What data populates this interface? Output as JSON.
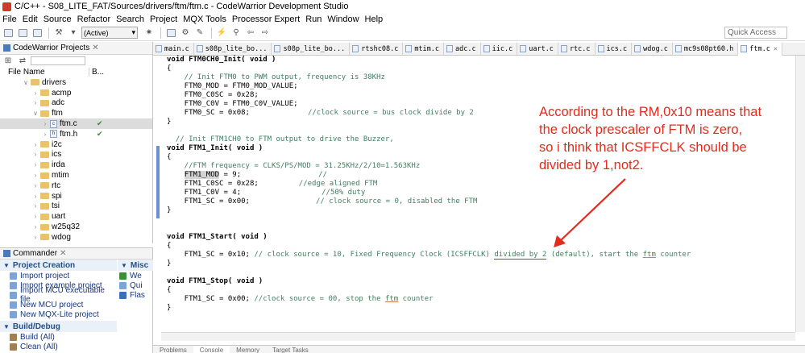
{
  "window": {
    "title": "C/C++ - S08_LITE_FAT/Sources/drivers/ftm/ftm.c - CodeWarrior Development Studio"
  },
  "menu": [
    "File",
    "Edit",
    "Source",
    "Refactor",
    "Search",
    "Project",
    "MQX Tools",
    "Processor Expert",
    "Run",
    "Window",
    "Help"
  ],
  "toolbar": {
    "build_config": "(Active)",
    "quick_access_placeholder": "Quick Access"
  },
  "projects_view": {
    "title": "CodeWarrior Projects",
    "col_file": "File Name",
    "col_b": "B...",
    "tree": [
      {
        "label": "drivers",
        "type": "folder",
        "open": true
      },
      {
        "label": "acmp",
        "type": "folder"
      },
      {
        "label": "adc",
        "type": "folder"
      },
      {
        "label": "ftm",
        "type": "folder",
        "open": true
      },
      {
        "label": "ftm.c",
        "type": "file",
        "mark": "✔",
        "selected": true
      },
      {
        "label": "ftm.h",
        "type": "file",
        "mark": "✔"
      },
      {
        "label": "i2c",
        "type": "folder"
      },
      {
        "label": "ics",
        "type": "folder"
      },
      {
        "label": "irda",
        "type": "folder"
      },
      {
        "label": "mtim",
        "type": "folder"
      },
      {
        "label": "rtc",
        "type": "folder"
      },
      {
        "label": "spi",
        "type": "folder"
      },
      {
        "label": "tsi",
        "type": "folder"
      },
      {
        "label": "uart",
        "type": "folder"
      },
      {
        "label": "w25q32",
        "type": "folder"
      },
      {
        "label": "wdog",
        "type": "folder"
      }
    ]
  },
  "commander": {
    "title": "Commander",
    "sections": [
      {
        "title": "Project Creation",
        "items": [
          "Import project",
          "Import example project",
          "Import MCU executable file",
          "New MCU project",
          "New MQX-Lite project"
        ]
      },
      {
        "title": "Build/Debug",
        "items": [
          "Build (All)",
          "Clean (All)"
        ]
      }
    ],
    "misc_title": "Misc",
    "misc_items": [
      "We",
      "Qui",
      "Flas"
    ]
  },
  "editor_tabs": [
    "main.c",
    "s08p_lite_bo...",
    "s08p_lite_bo...",
    "rtshc08.c",
    "mtim.c",
    "adc.c",
    "iic.c",
    "uart.c",
    "rtc.c",
    "ics.c",
    "wdog.c",
    "mc9s08pt60.h",
    "ftm.c"
  ],
  "code": {
    "l1": "void FTM0CH0_Init( void )",
    "l2": "{",
    "l3": "    // Init FTM0 to PWM output, frequency is 38KHz",
    "l4": "    FTM0_MOD = FTM0_MOD_VALUE;",
    "l5": "    FTM0_C0SC = 0x28;",
    "l6": "    FTM0_C0V = FTM0_C0V_VALUE;",
    "l7a": "    FTM0_SC = 0x08;",
    "l7b": "//clock source = bus clock divide by 2",
    "l8": "}",
    "l9": "  // Init FTM1CH0 to FTM output to drive the Buzzer,",
    "l10": "void FTM1_Init( void )",
    "l11": "{",
    "l12": "    //FTM frequency = CLKS/PS/MOD = 31.25KHz/2/10=1.563KHz",
    "l13a": "FTM1_MOD",
    "l13b": " = 9;",
    "l13c": "//",
    "l14a": "    FTM1_C0SC = 0x28;",
    "l14b": "//edge aligned FTM",
    "l15a": "    FTM1_C0V = 4;",
    "l15b": "//50% duty",
    "l16a": "    FTM1_SC = 0x00;",
    "l16b": "// clock source = 0, disabled the FTM",
    "l17": "}",
    "l18": "void FTM1_Start( void )",
    "l19": "{",
    "l20a": "    FTM1_SC = 0x10;",
    "l20b": " // clock source = 10, Fixed Frequency Clock (ICSFFCLK) ",
    "l20c": "divided by 2",
    "l20d": " (default), start the ",
    "l20e": "ftm",
    "l20f": " counter",
    "l21": "}",
    "l22": "void FTM1_Stop( void )",
    "l23": "{",
    "l24a": "    FTM1_SC = 0x00;",
    "l24b": " //clock source = 00, stop the ",
    "l24c": "ftm",
    "l24d": " counter",
    "l25": "}"
  },
  "bottom_tabs": [
    "Problems",
    "Console",
    "Memory",
    "Target Tasks"
  ],
  "annotation": {
    "lines": [
      "According to the RM,0x10 means that",
      "the clock prescaler of FTM is zero,",
      "so i think that ICSFFCLK should be",
      "divided by 1,not2."
    ],
    "color": "#e52a1e"
  }
}
